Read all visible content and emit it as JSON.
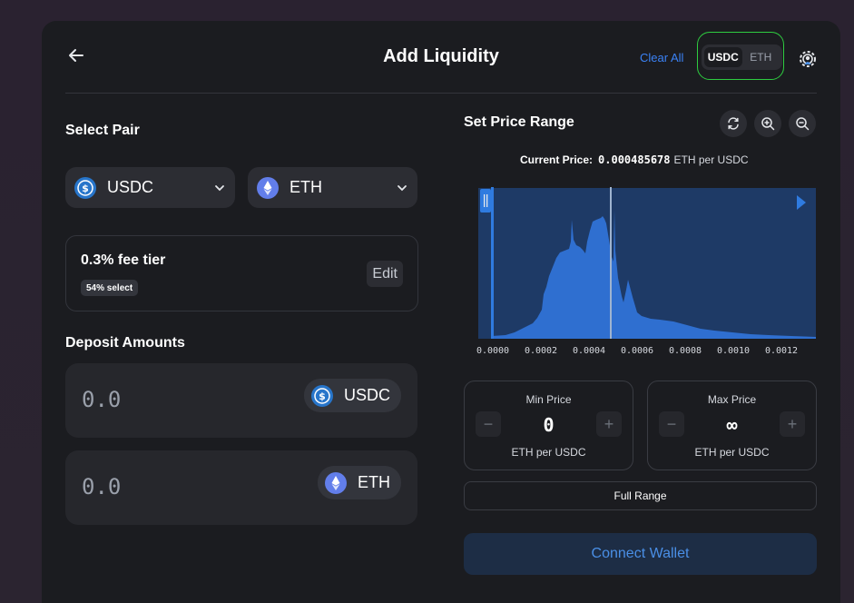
{
  "header": {
    "title": "Add Liquidity",
    "clear_all": "Clear All",
    "toggle": {
      "options": [
        "USDC",
        "ETH"
      ],
      "selected": "USDC"
    }
  },
  "select_pair": {
    "label": "Select Pair",
    "token_a": {
      "symbol": "USDC",
      "icon": "usdc-icon"
    },
    "token_b": {
      "symbol": "ETH",
      "icon": "eth-icon"
    }
  },
  "fee": {
    "title": "0.3% fee tier",
    "badge": "54% select",
    "edit_label": "Edit"
  },
  "deposit": {
    "label": "Deposit Amounts",
    "amount_a": {
      "value": "0.0",
      "symbol": "USDC"
    },
    "amount_b": {
      "value": "0.0",
      "symbol": "ETH"
    }
  },
  "price_range": {
    "label": "Set Price Range",
    "current_price_label": "Current Price:",
    "current_price_value": "0.000485678",
    "current_price_unit": "ETH per USDC",
    "ticks": [
      "0.0000",
      "0.0002",
      "0.0004",
      "0.0006",
      "0.0008",
      "0.0010",
      "0.0012"
    ],
    "min": {
      "title": "Min Price",
      "value": "0",
      "unit": "ETH per USDC"
    },
    "max": {
      "title": "Max Price",
      "value": "∞",
      "unit": "ETH per USDC"
    },
    "full_range_label": "Full Range"
  },
  "connect_wallet": "Connect Wallet",
  "colors": {
    "accent": "#3b82f6",
    "chart_bar": "#2f6fd0",
    "chart_bg": "#1e3a66",
    "card": "#1b1c20"
  }
}
